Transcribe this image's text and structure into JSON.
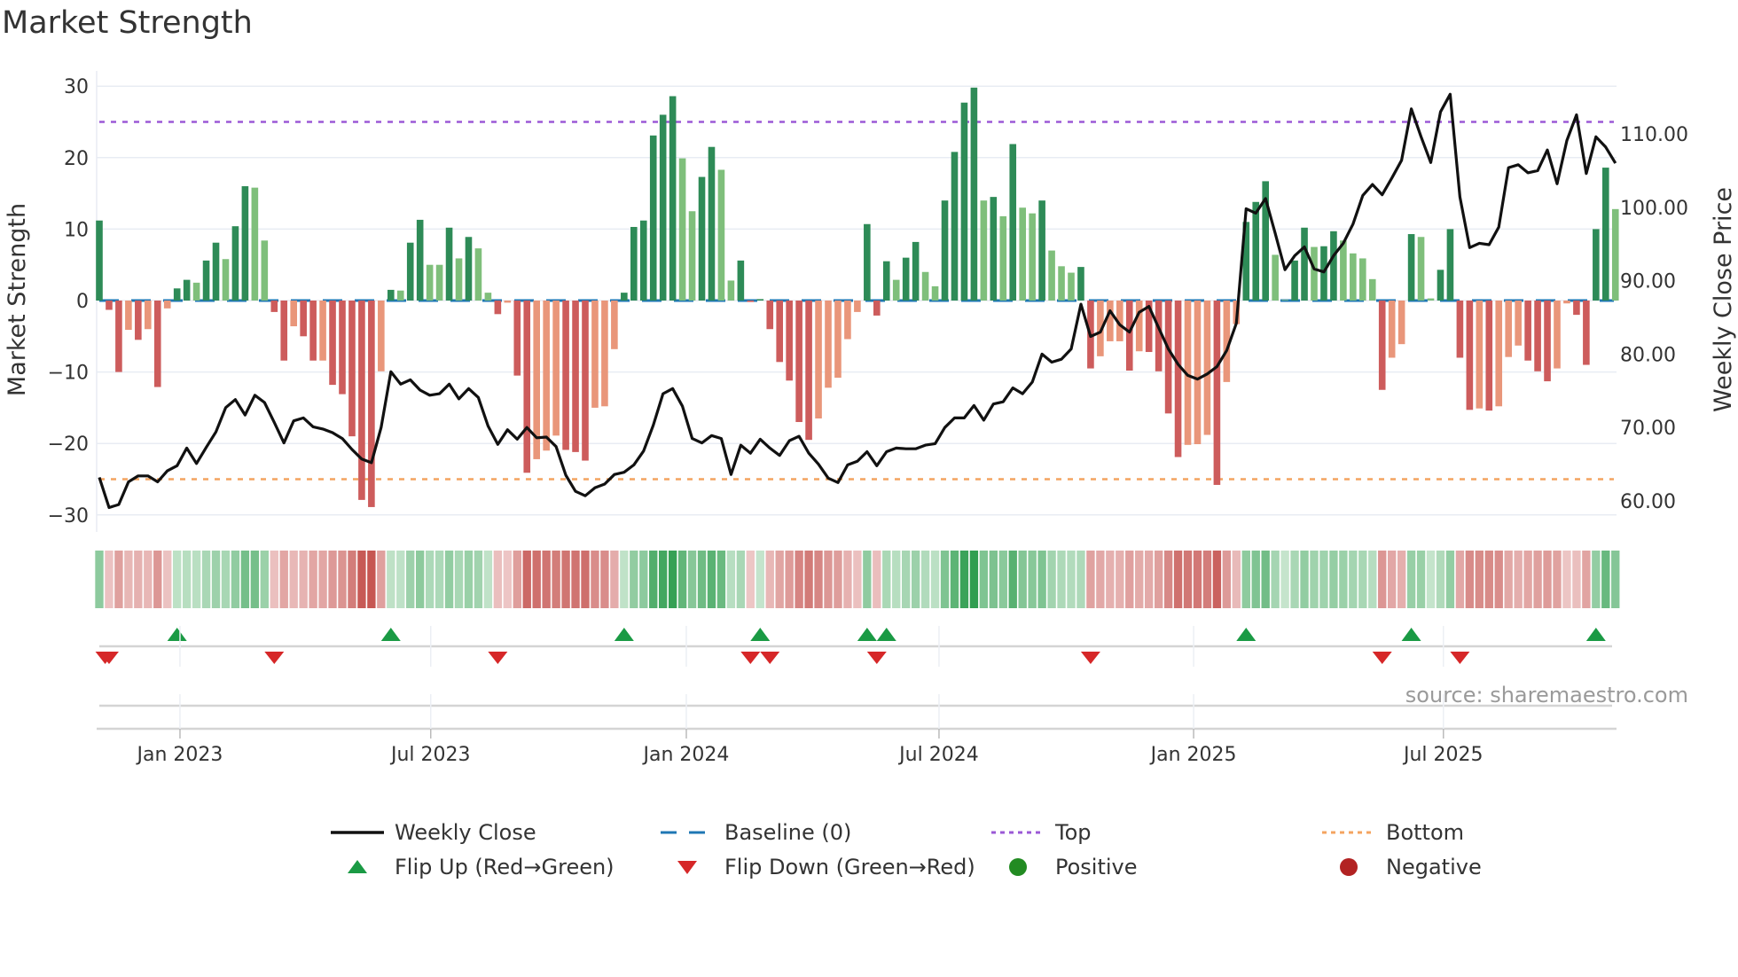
{
  "title": "Market Strength",
  "source": "source: sharemaestro.com",
  "legend": {
    "weekly_close": "Weekly Close",
    "baseline": "Baseline (0)",
    "top": "Top",
    "bottom": "Bottom",
    "flip_up": "Flip Up (Red→Green)",
    "flip_down": "Flip Down (Green→Red)",
    "positive": "Positive",
    "negative": "Negative"
  },
  "colors": {
    "pos_strong": "#2e8b57",
    "pos_weak": "#7fbf7b",
    "neg_strong": "#cd5c5c",
    "neg_weak": "#e9967a",
    "baseline": "#1f77b4",
    "top": "#9b59d6",
    "bottom": "#f4a460",
    "flip_up": "#1a9a44",
    "flip_down": "#d62728",
    "positive": "#228b22",
    "negative": "#b22222",
    "close": "#111111"
  },
  "chart_data": {
    "type": "bar",
    "title": "Market Strength",
    "ylabel": "Market Strength",
    "y2label": "Weekly Close Price",
    "ylim": [
      -31.5,
      32.5
    ],
    "y2lim": [
      58.07,
      116.5
    ],
    "yticks": [
      "30",
      "20",
      "10",
      "0",
      "−10",
      "−20",
      "−30"
    ],
    "ytick_values": [
      30,
      20,
      10,
      0,
      -10,
      -20,
      -30
    ],
    "y2ticks": [
      "110.00",
      "100.00",
      "90.00",
      "80.00",
      "70.00",
      "60.00"
    ],
    "y2tick_values": [
      110,
      100,
      90,
      80,
      70,
      60
    ],
    "xticks": [
      "Jan 2023",
      "Jul 2023",
      "Jan 2024",
      "Jul 2024",
      "Jan 2025",
      "Jul 2025"
    ],
    "xtick_weeks": [
      8.3,
      34.1,
      60.4,
      86.4,
      112.6,
      138.3
    ],
    "top_level": 25,
    "bottom_level": -25,
    "baseline": 0,
    "strength": [
      11.2,
      -1.3,
      -10,
      -4.1,
      -5.5,
      -4,
      -12.1,
      -1.1,
      1.7,
      2.9,
      2.5,
      5.6,
      8.1,
      5.8,
      10.4,
      16,
      15.8,
      8.4,
      -1.6,
      -8.4,
      -3.6,
      -5,
      -8.4,
      -8.4,
      -11.8,
      -13.1,
      -19,
      -27.9,
      -28.9,
      -9.9,
      1.5,
      1.4,
      8.1,
      11.3,
      5,
      5,
      10.2,
      5.9,
      8.9,
      7.3,
      1.1,
      -1.9,
      -0.3,
      -10.5,
      -24.1,
      -22.2,
      -21,
      -18.9,
      -20.9,
      -21.2,
      -22.4,
      -15,
      -14.8,
      -6.8,
      1.1,
      10.3,
      11.2,
      23.1,
      26,
      28.6,
      19.9,
      12.5,
      17.3,
      21.5,
      18.3,
      2.8,
      5.6,
      -0.2,
      0.2,
      -4,
      -8.6,
      -11.2,
      -17,
      -19.5,
      -16.5,
      -12.2,
      -10.8,
      -5.4,
      -1.6,
      10.7,
      -2.1,
      5.5,
      2.9,
      6,
      8.2,
      4,
      2,
      14,
      20.8,
      27.7,
      29.8,
      14,
      14.5,
      11.8,
      21.9,
      13,
      12.2,
      14,
      7,
      4.8,
      3.9,
      4.7,
      -9.5,
      -7.8,
      -5.7,
      -5.7,
      -9.8,
      -7.1,
      -7.2,
      -9.9,
      -15.8,
      -21.9,
      -20.2,
      -20.1,
      -18.8,
      -25.8,
      -11.4,
      -3.3,
      11,
      13.8,
      16.7,
      6.4,
      0.1,
      5.6,
      10.2,
      7.5,
      7.6,
      9.7,
      8.4,
      6.6,
      5.9,
      3,
      -12.5,
      -8,
      -6.1,
      9.3,
      8.9,
      0.3,
      4.3,
      10,
      -8,
      -15.3,
      -15.1,
      -15.4,
      -14.8,
      -7.9,
      -6.3,
      -8.4,
      -9.9,
      -11.3,
      -9.5,
      -0.4,
      -2,
      -9,
      10,
      18.6,
      12.8
    ],
    "weekly_close": [
      63.2,
      59.1,
      59.5,
      62.6,
      63.4,
      63.4,
      62.6,
      64.1,
      64.8,
      67.2,
      65.1,
      67.3,
      69.4,
      72.7,
      73.8,
      71.7,
      74.4,
      73.4,
      70.7,
      67.9,
      70.9,
      71.3,
      70.1,
      69.8,
      69.3,
      68.5,
      67.0,
      65.7,
      65.2,
      70.0,
      77.6,
      75.9,
      76.5,
      75.1,
      74.4,
      74.6,
      75.9,
      73.9,
      75.3,
      74.1,
      70.2,
      67.7,
      69.7,
      68.4,
      70.0,
      68.6,
      68.7,
      67.4,
      63.5,
      61.3,
      60.7,
      61.8,
      62.3,
      63.6,
      63.9,
      64.9,
      66.8,
      70.3,
      74.6,
      75.3,
      72.9,
      68.5,
      67.9,
      68.9,
      68.5,
      63.6,
      67.6,
      66.5,
      68.4,
      67.2,
      66.2,
      68.2,
      68.8,
      66.5,
      65.0,
      63.1,
      62.5,
      64.9,
      65.4,
      66.7,
      64.8,
      66.7,
      67.2,
      67.1,
      67.1,
      67.6,
      67.8,
      70.0,
      71.3,
      71.3,
      73.0,
      71.0,
      73.2,
      73.5,
      75.4,
      74.6,
      76.2,
      80.0,
      78.9,
      79.3,
      80.7,
      86.8,
      82.4,
      83.0,
      85.9,
      84.0,
      83.0,
      85.7,
      86.5,
      83.6,
      80.7,
      78.6,
      77.1,
      76.6,
      77.3,
      78.3,
      80.5,
      84.2,
      99.8,
      99.2,
      101.2,
      96.4,
      91.5,
      93.4,
      94.6,
      91.6,
      91.2,
      93.4,
      95.1,
      97.7,
      101.6,
      103.1,
      101.7,
      104.0,
      106.4,
      113.4,
      109.6,
      106.1,
      113.0,
      115.4,
      101.4,
      94.5,
      95.1,
      94.9,
      97.3,
      105.4,
      105.8,
      104.7,
      105.0,
      107.8,
      103.2,
      109.1,
      112.6,
      104.6,
      109.6,
      108.2,
      106.0
    ],
    "grid": true,
    "legend_position": "bottom"
  }
}
